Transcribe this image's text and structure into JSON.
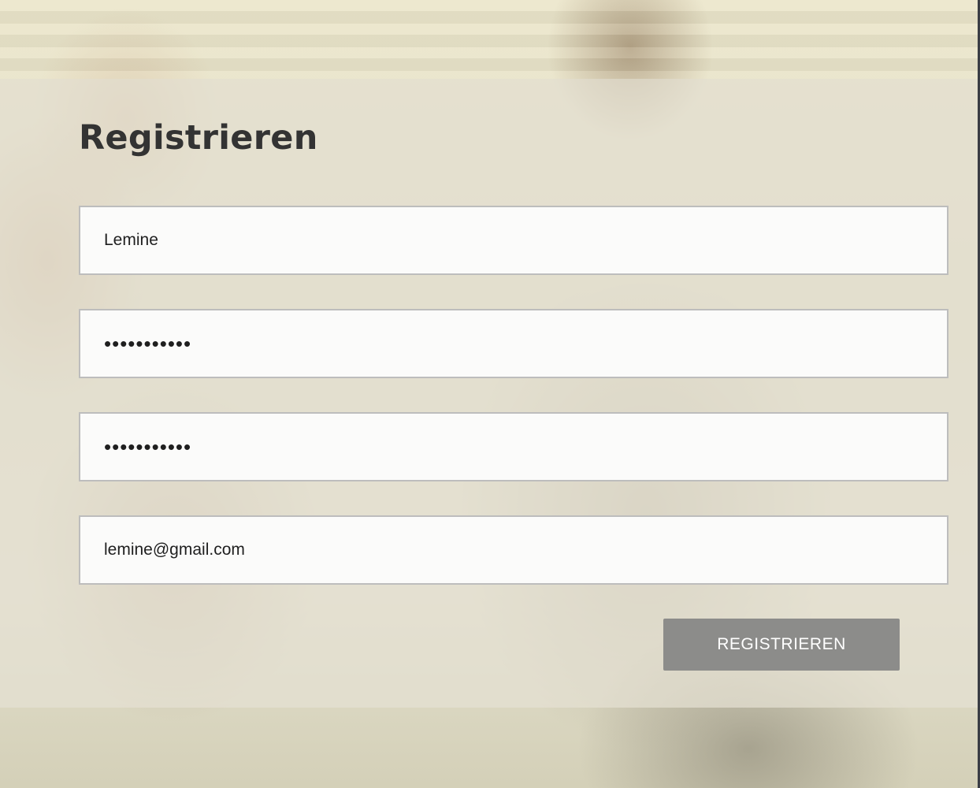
{
  "form": {
    "title": "Registrieren",
    "fields": [
      {
        "name": "username",
        "type": "text",
        "value": "Lemine"
      },
      {
        "name": "password",
        "type": "password",
        "value": "abcdefghijk"
      },
      {
        "name": "password-confirm",
        "type": "password",
        "value": "abcdefghijk"
      },
      {
        "name": "email",
        "type": "email",
        "value": "lemine@gmail.com"
      }
    ],
    "submit_label": "REGISTRIEREN"
  },
  "colors": {
    "panel": "#e4e1d2",
    "title": "#333333",
    "field_border": "#bdbdbd",
    "field_background": "#fbfbfa",
    "button_background": "#8c8c8a",
    "button_text": "#ffffff"
  }
}
